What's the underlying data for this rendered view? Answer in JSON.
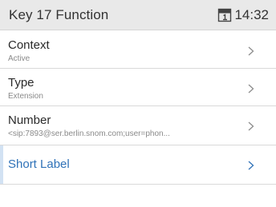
{
  "header": {
    "title": "Key 17 Function",
    "clock": "14:32"
  },
  "items": [
    {
      "label": "Context",
      "value": "Active"
    },
    {
      "label": "Type",
      "value": "Extension"
    },
    {
      "label": "Number",
      "value": "<sip:7893@ser.berlin.snom.com;user=phon..."
    },
    {
      "label": "Short Label",
      "value": ""
    }
  ],
  "colors": {
    "header_bg": "#e9e9e9",
    "accent": "#2f72b8",
    "divider": "#d9d9d9",
    "selection_bar": "#d2e2f3"
  },
  "icons": {
    "status": "key-lock-icon",
    "row": "chevron-right-icon"
  }
}
